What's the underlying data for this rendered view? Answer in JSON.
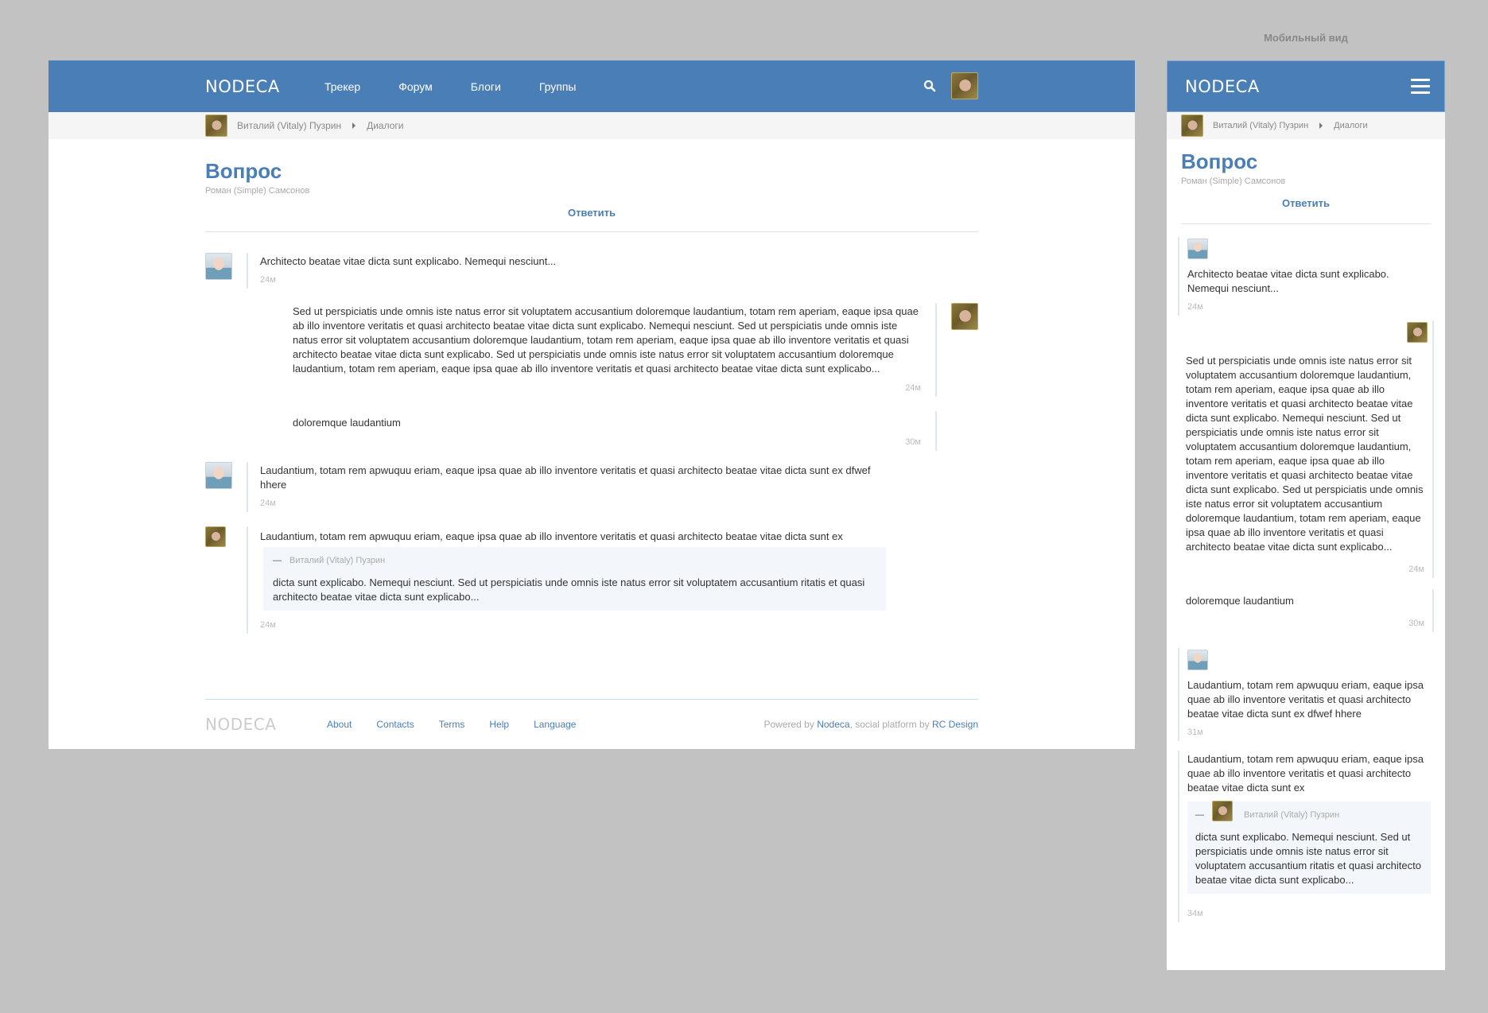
{
  "desktop": {
    "brand": "NODECA",
    "nav": [
      "Трекер",
      "Форум",
      "Блоги",
      "Группы"
    ],
    "breadcrumb": {
      "user": "Виталий (Vitaly) Пузрин",
      "section": "Диалоги"
    },
    "title": "Вопрос",
    "subtitle": "Роман (Simple) Самсонов",
    "reply": "Ответить",
    "messages": [
      {
        "text": "Architecto beatae vitae dicta sunt explicabo. Nemequi nesciunt...",
        "time": "24м"
      },
      {
        "text": "Sed ut perspiciatis unde omnis iste natus error sit voluptatem accusantium doloremque laudantium, totam rem aperiam, eaque ipsa quae ab illo inventore veritatis et quasi architecto beatae vitae dicta sunt explicabo. Nemequi nesciunt. Sed ut perspiciatis unde omnis iste natus error sit voluptatem accusantium doloremque laudantium, totam rem aperiam, eaque ipsa quae ab illo inventore veritatis et quasi architecto beatae vitae dicta sunt explicabo. Sed ut perspiciatis unde omnis iste natus error sit voluptatem accusantium doloremque laudantium, totam rem aperiam, eaque ipsa quae ab illo inventore veritatis et quasi architecto beatae vitae dicta sunt explicabo...",
        "time": "24м"
      },
      {
        "text": "doloremque laudantium",
        "time": "30м"
      },
      {
        "text": "Laudantium, totam rem apwuquu eriam, eaque ipsa quae ab illo inventore veritatis et quasi architecto beatae vitae dicta sunt ex dfwef hhere",
        "time": "24м"
      },
      {
        "text": "Laudantium, totam rem apwuquu eriam, eaque ipsa quae ab illo inventore veritatis et quasi architecto beatae vitae dicta sunt ex",
        "quote_dash": "—",
        "quote_author": "Виталий (Vitaly) Пузрин",
        "quote_text": "dicta sunt explicabo. Nemequi nesciunt. Sed ut perspiciatis unde omnis iste natus error sit voluptatem accusantium ritatis et quasi architecto beatae vitae dicta sunt explicabo...",
        "time": "24м"
      }
    ],
    "footer": {
      "brand": "NODECA",
      "links": [
        "About",
        "Contacts",
        "Terms",
        "Help",
        "Language"
      ],
      "powered_prefix": "Powered by",
      "powered_link": "Nodeca",
      "powered_mid": ", social platform by",
      "powered_link2": "RC Design"
    }
  },
  "mobile": {
    "label": "Мобильный вид",
    "brand": "NODECA",
    "breadcrumb": {
      "user": "Виталий (Vitaly) Пузрин",
      "section": "Диалоги"
    },
    "title": "Вопрос",
    "subtitle": "Роман (Simple) Самсонов",
    "reply": "Ответить",
    "messages": [
      {
        "text": "Architecto beatae vitae dicta sunt explicabo. Nemequi nesciunt...",
        "time": "24м"
      },
      {
        "text": "Sed ut perspiciatis unde omnis iste natus error sit voluptatem accusantium doloremque laudantium, totam rem aperiam, eaque ipsa quae ab illo inventore veritatis et quasi architecto beatae vitae dicta sunt explicabo. Nemequi nesciunt. Sed ut perspiciatis unde omnis iste natus error sit voluptatem accusantium doloremque laudantium, totam rem aperiam, eaque ipsa quae ab illo inventore veritatis et quasi architecto beatae vitae dicta sunt explicabo. Sed ut perspiciatis unde omnis iste natus error sit voluptatem accusantium doloremque laudantium, totam rem aperiam, eaque ipsa quae ab illo inventore veritatis et quasi architecto beatae vitae dicta sunt explicabo...",
        "time": "24м"
      },
      {
        "text": "doloremque laudantium",
        "time": "30м"
      },
      {
        "text": "Laudantium, totam rem apwuquu eriam, eaque ipsa quae ab illo inventore veritatis et quasi architecto beatae vitae dicta sunt ex dfwef hhere",
        "time": "31м"
      },
      {
        "text": "Laudantium, totam rem apwuquu eriam, eaque ipsa quae ab illo inventore veritatis et quasi architecto beatae vitae dicta sunt ex",
        "quote_dash": "—",
        "quote_author": "Виталий (Vitaly) Пузрин",
        "quote_text": "dicta sunt explicabo. Nemequi nesciunt. Sed ut perspiciatis unde omnis iste natus error sit voluptatem accusantium ritatis et quasi architecto beatae vitae dicta sunt explicabo...",
        "time": "34м"
      }
    ]
  },
  "colors": {
    "accent": "#4a7eb7",
    "page_bg": "#c2c2c2",
    "muted": "#aaaaaa"
  },
  "icons": {
    "search": "search-icon",
    "menu": "hamburger-menu-icon",
    "caret": "caret-right-icon"
  }
}
